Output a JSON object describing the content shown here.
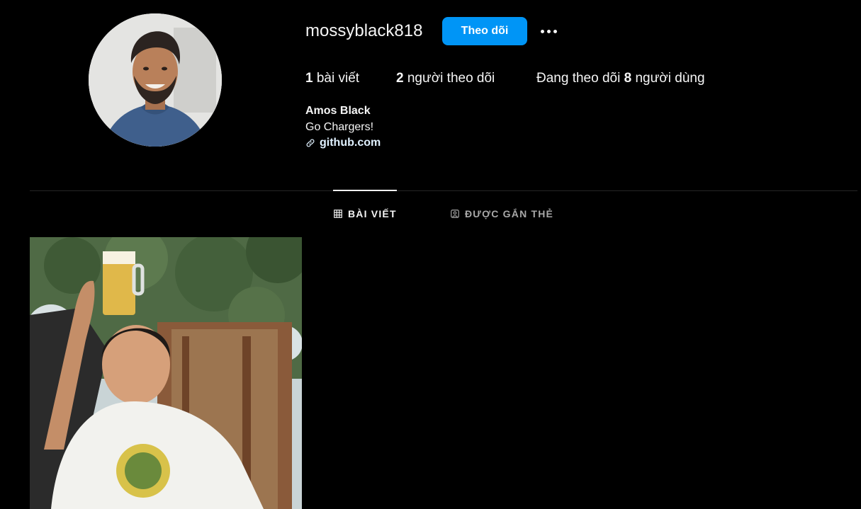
{
  "profile": {
    "username": "mossyblack818",
    "follow_label": "Theo dõi",
    "avatar_icon": "profile-photo",
    "more_icon": "more-options-icon"
  },
  "stats": {
    "posts_count": "1",
    "posts_label": " bài viết",
    "followers_count": "2",
    "followers_label": " người theo dõi",
    "following_prefix": "Đang theo dõi ",
    "following_count": "8",
    "following_suffix": " người dùng"
  },
  "bio": {
    "full_name": "Amos Black",
    "text": "Go Chargers!",
    "link": "github.com",
    "link_icon": "link-icon"
  },
  "tabs": [
    {
      "label": "BÀI VIẾT",
      "icon": "grid-icon",
      "active": true
    },
    {
      "label": "ĐƯỢC GẮN THẺ",
      "icon": "tagged-icon",
      "active": false
    }
  ],
  "posts": [
    {
      "thumbnail": "man-raising-beer-mug-photo"
    }
  ],
  "colors": {
    "background": "#000000",
    "follow_button": "#0095f6",
    "text_primary": "#f5f5f5",
    "text_secondary": "#a8a8a8",
    "divider": "#262626"
  }
}
